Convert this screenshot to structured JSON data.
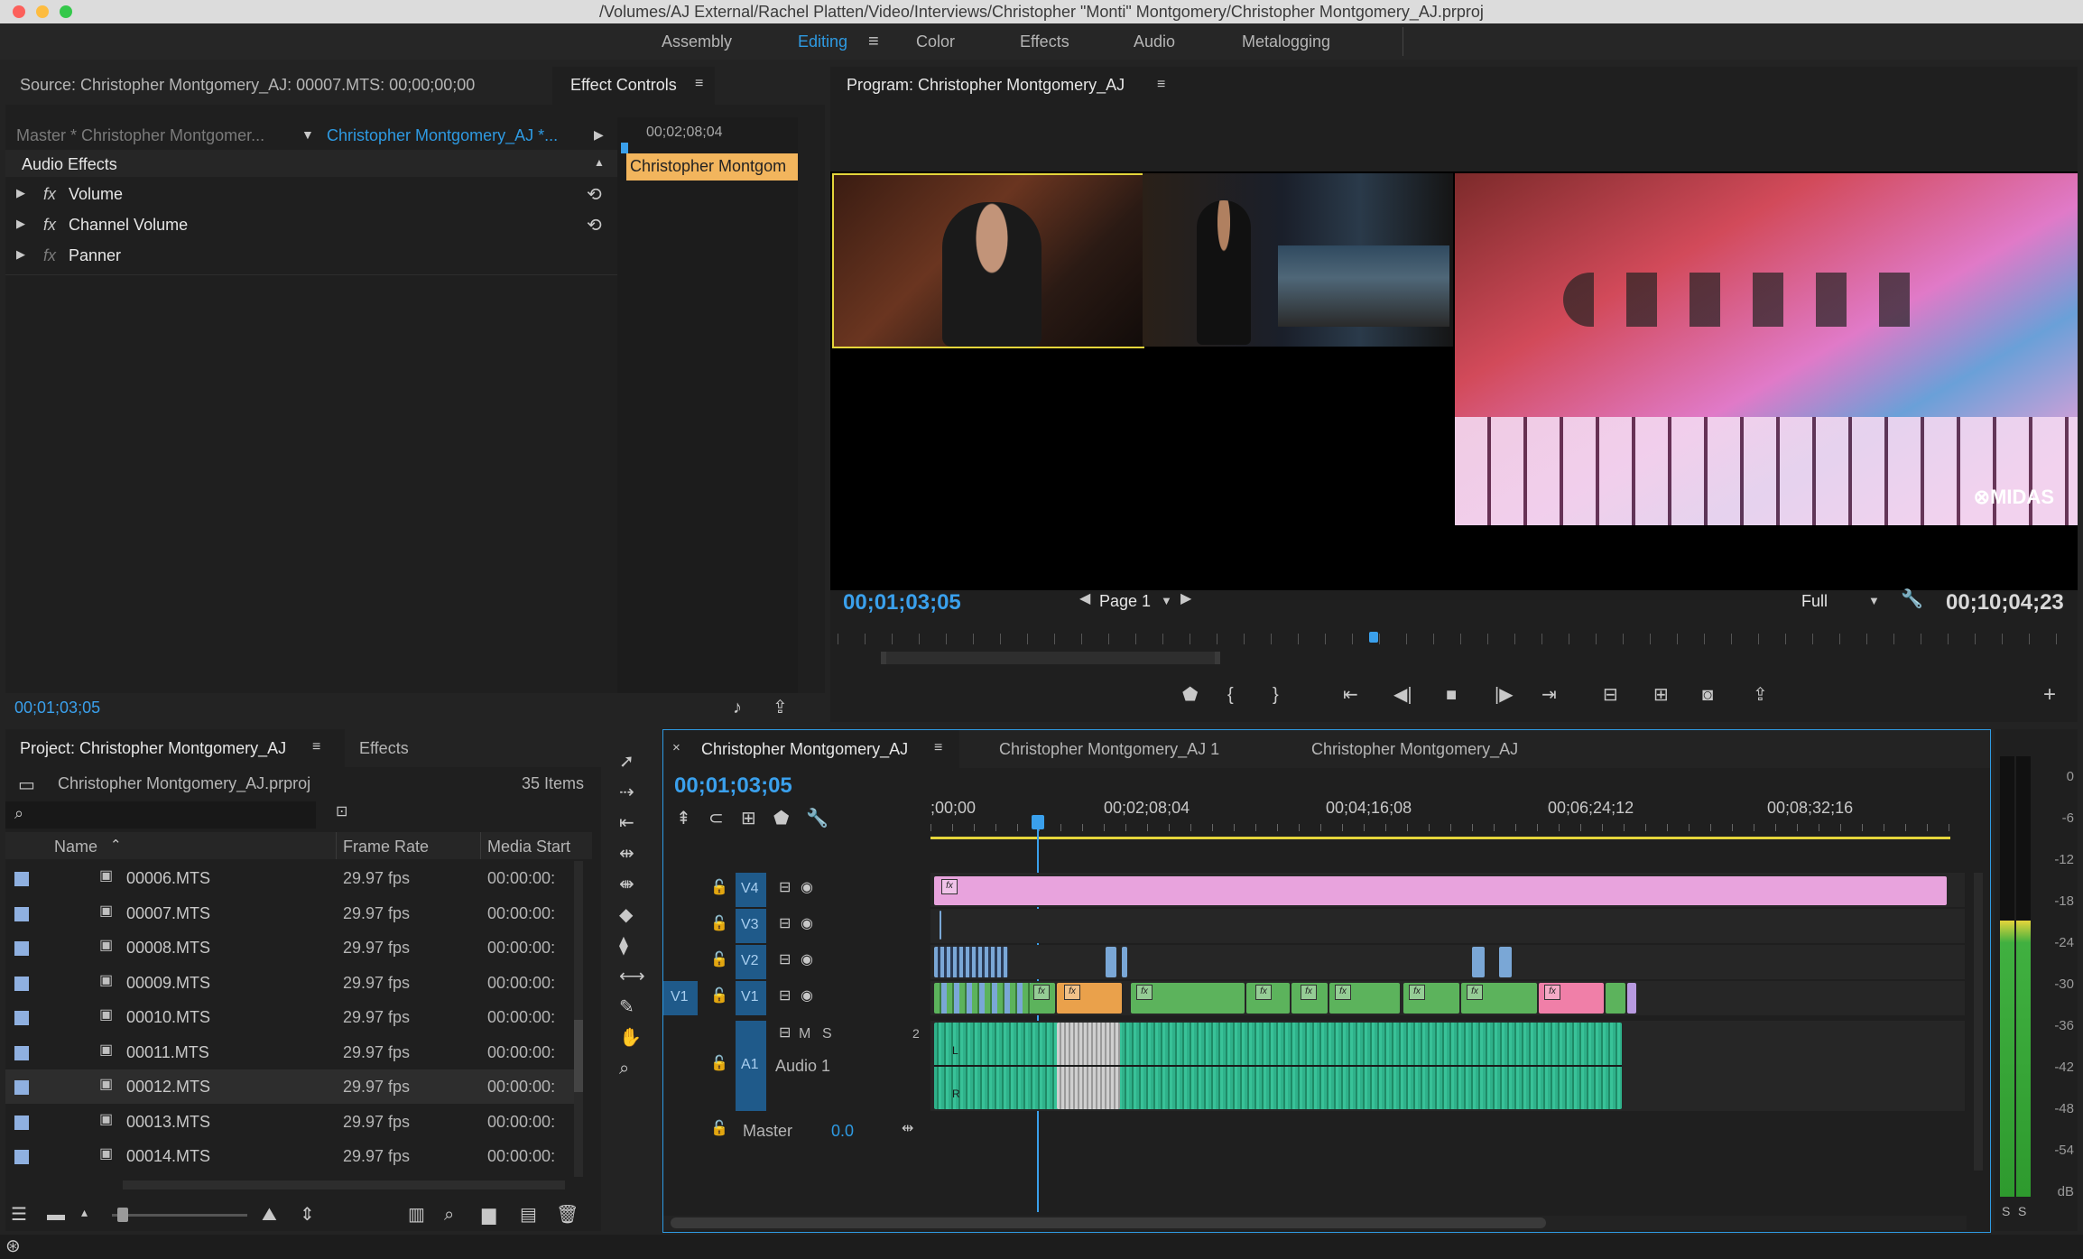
{
  "window": {
    "title": "/Volumes/AJ External/Rachel Platten/Video/Interviews/Christopher \"Monti\" Montgomery/Christopher Montgomery_AJ.prproj"
  },
  "workspaces": [
    "Assembly",
    "Editing",
    "Color",
    "Effects",
    "Audio",
    "Metalogging"
  ],
  "active_workspace": "Editing",
  "source_panel": {
    "source_tab": "Source: Christopher Montgomery_AJ: 00007.MTS: 00;00;00;00",
    "effect_controls_tab": "Effect Controls",
    "master_label": "Master * Christopher Montgomer...",
    "sequence_label": "Christopher Montgomery_AJ *...",
    "ruler_time": "00;02;08;04",
    "clip_label": "Christopher Montgom",
    "section": "Audio Effects",
    "effects": [
      "Volume",
      "Channel Volume",
      "Panner"
    ],
    "fx_glyph": "fx",
    "timecode": "00;01;03;05"
  },
  "program": {
    "title": "Program: Christopher Montgomery_AJ",
    "timecode": "00;01;03;05",
    "page": "Page 1",
    "zoom": "Full",
    "duration": "00;10;04;23",
    "watermark": "⊗MIDAS"
  },
  "project": {
    "title": "Project: Christopher Montgomery_AJ",
    "effects_tab": "Effects",
    "file": "Christopher Montgomery_AJ.prproj",
    "count": "35 Items",
    "columns": [
      "Name",
      "Frame Rate",
      "Media Start"
    ],
    "rows": [
      {
        "name": "00006.MTS",
        "fps": "29.97 fps",
        "start": "00:00:00:"
      },
      {
        "name": "00007.MTS",
        "fps": "29.97 fps",
        "start": "00:00:00:"
      },
      {
        "name": "00008.MTS",
        "fps": "29.97 fps",
        "start": "00:00:00:"
      },
      {
        "name": "00009.MTS",
        "fps": "29.97 fps",
        "start": "00:00:00:"
      },
      {
        "name": "00010.MTS",
        "fps": "29.97 fps",
        "start": "00:00:00:"
      },
      {
        "name": "00011.MTS",
        "fps": "29.97 fps",
        "start": "00:00:00:"
      },
      {
        "name": "00012.MTS",
        "fps": "29.97 fps",
        "start": "00:00:00:"
      },
      {
        "name": "00013.MTS",
        "fps": "29.97 fps",
        "start": "00:00:00:"
      },
      {
        "name": "00014.MTS",
        "fps": "29.97 fps",
        "start": "00:00:00:"
      }
    ]
  },
  "timeline": {
    "tabs": [
      "Christopher Montgomery_AJ",
      "Christopher Montgomery_AJ 1",
      "Christopher Montgomery_AJ"
    ],
    "timecode": "00;01;03;05",
    "ruler": [
      ";00;00",
      "00;02;08;04",
      "00;04;16;08",
      "00;06;24;12",
      "00;08;32;16"
    ],
    "tracks": [
      "V4",
      "V3",
      "V2",
      "V1"
    ],
    "source_patch": "V1",
    "audio_track": "A1",
    "audio_name": "Audio 1",
    "audio_m": "M",
    "audio_s": "S",
    "audio_channels": "2",
    "master_label": "Master",
    "master_value": "0.0",
    "lr": [
      "L",
      "R"
    ]
  },
  "meter": {
    "labels": [
      "0",
      "-6",
      "-12",
      "-18",
      "-24",
      "-30",
      "-36",
      "-42",
      "-48",
      "-54",
      "dB"
    ],
    "solo": [
      "S",
      "S"
    ]
  },
  "colors": {
    "accent": "#2e9ae2",
    "v4_clip": "#e8a3dd",
    "v1_clip": "#5cb35c",
    "audio_clip": "#2fb18a",
    "orange_clip": "#eaa14b",
    "pink_clip": "#f07fa8"
  }
}
